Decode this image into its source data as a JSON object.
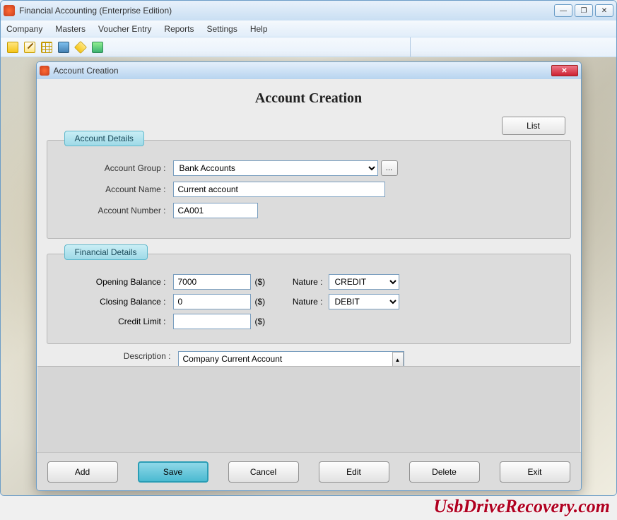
{
  "window": {
    "title": "Financial Accounting (Enterprise Edition)"
  },
  "menu": {
    "items": [
      "Company",
      "Masters",
      "Voucher Entry",
      "Reports",
      "Settings",
      "Help"
    ]
  },
  "dialog": {
    "title": "Account Creation",
    "heading": "Account Creation",
    "list_label": "List",
    "close_glyph": "✕",
    "account_details": {
      "legend": "Account Details",
      "group_label": "Account Group :",
      "group_value": "Bank Accounts",
      "ellipsis": "...",
      "name_label": "Account Name :",
      "name_value": "Current account",
      "number_label": "Account Number :",
      "number_value": "CA001"
    },
    "financial_details": {
      "legend": "Financial Details",
      "opening_label": "Opening Balance :",
      "opening_value": "7000",
      "closing_label": "Closing Balance :",
      "closing_value": "0",
      "credit_limit_label": "Credit Limit :",
      "credit_limit_value": "",
      "currency": "($)",
      "nature_label": "Nature :",
      "nature1_value": "CREDIT",
      "nature2_value": "DEBIT"
    },
    "description_label": "Description :",
    "description_value": "Company Current Account",
    "footer": {
      "add": "Add",
      "save": "Save",
      "cancel": "Cancel",
      "edit": "Edit",
      "delete": "Delete",
      "exit": "Exit"
    }
  },
  "watermark": "UsbDriveRecovery.com"
}
